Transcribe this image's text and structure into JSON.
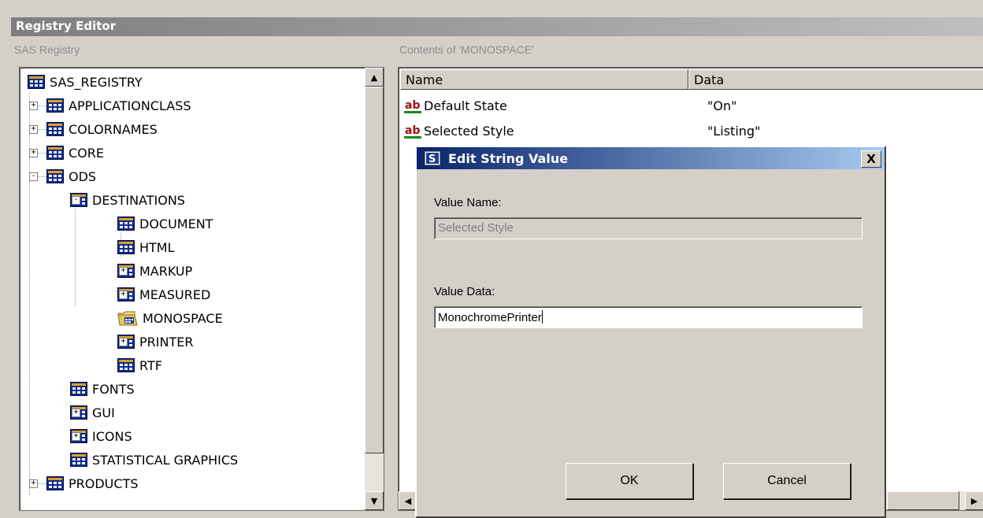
{
  "window": {
    "title": "Registry Editor"
  },
  "left_panel": {
    "label": "SAS Registry"
  },
  "tree": [
    {
      "label": "SAS_REGISTRY",
      "level": 0,
      "expander": "",
      "icon": "registry-key"
    },
    {
      "label": "APPLICATIONCLASS",
      "level": 1,
      "expander": "+",
      "icon": "registry-key"
    },
    {
      "label": "COLORNAMES",
      "level": 1,
      "expander": "+",
      "icon": "registry-key"
    },
    {
      "label": "CORE",
      "level": 1,
      "expander": "+",
      "icon": "registry-key"
    },
    {
      "label": "ODS",
      "level": 1,
      "expander": "-",
      "icon": "registry-key"
    },
    {
      "label": "DESTINATIONS",
      "level": 2,
      "expander": "-",
      "icon": "registry-key"
    },
    {
      "label": "DOCUMENT",
      "level": 3,
      "expander": "",
      "icon": "registry-key"
    },
    {
      "label": "HTML",
      "level": 3,
      "expander": "",
      "icon": "registry-key"
    },
    {
      "label": "MARKUP",
      "level": 3,
      "expander": "+",
      "icon": "registry-key"
    },
    {
      "label": "MEASURED",
      "level": 3,
      "expander": "+",
      "icon": "registry-key"
    },
    {
      "label": "MONOSPACE",
      "level": 3,
      "expander": "",
      "icon": "open-folder"
    },
    {
      "label": "PRINTER",
      "level": 3,
      "expander": "+",
      "icon": "registry-key"
    },
    {
      "label": "RTF",
      "level": 3,
      "expander": "",
      "icon": "registry-key"
    },
    {
      "label": "FONTS",
      "level": 2,
      "expander": "",
      "icon": "registry-key"
    },
    {
      "label": "GUI",
      "level": 2,
      "expander": "+",
      "icon": "registry-key"
    },
    {
      "label": "ICONS",
      "level": 2,
      "expander": "+",
      "icon": "registry-key"
    },
    {
      "label": "STATISTICAL GRAPHICS",
      "level": 2,
      "expander": "",
      "icon": "registry-key"
    },
    {
      "label": "PRODUCTS",
      "level": 1,
      "expander": "+",
      "icon": "registry-key"
    }
  ],
  "right_panel": {
    "label": "Contents of 'MONOSPACE'"
  },
  "list": {
    "columns": [
      "Name",
      "Data"
    ],
    "rows": [
      {
        "name": "Default State",
        "data": "\"On\"",
        "icon": "string-value"
      },
      {
        "name": "Selected Style",
        "data": "\"Listing\"",
        "icon": "string-value"
      }
    ]
  },
  "dialog": {
    "title": "Edit String Value",
    "value_name_label": "Value Name:",
    "value_name": "Selected Style",
    "value_data_label": "Value Data:",
    "value_data": "MonochromePrinter",
    "ok_label": "OK",
    "cancel_label": "Cancel",
    "close_glyph": "X"
  },
  "scroll_glyphs": {
    "up": "▲",
    "down": "▼",
    "left": "◀",
    "right": "▶"
  }
}
